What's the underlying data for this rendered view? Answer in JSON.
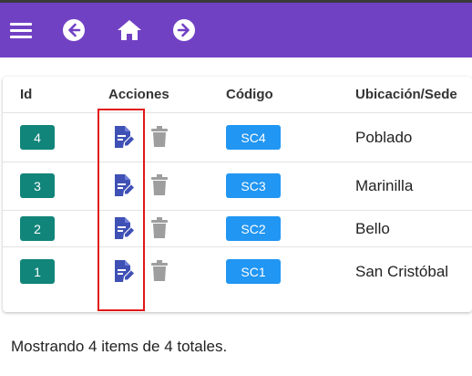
{
  "nav": {
    "menu_icon": "hamburger-icon",
    "back_icon": "arrow-left-circle-icon",
    "home_icon": "home-icon",
    "forward_icon": "arrow-right-circle-icon"
  },
  "table": {
    "headers": {
      "id": "Id",
      "actions": "Acciones",
      "code": "Código",
      "location": "Ubicación/Sede"
    },
    "rows": [
      {
        "id": "4",
        "code": "SC4",
        "location": "Poblado"
      },
      {
        "id": "3",
        "code": "SC3",
        "location": "Marinilla"
      },
      {
        "id": "2",
        "code": "SC2",
        "location": "Bello"
      },
      {
        "id": "1",
        "code": "SC1",
        "location": "San Cristóbal"
      }
    ],
    "edit_icon": "edit-document-icon",
    "delete_icon": "trash-icon"
  },
  "footer": {
    "summary": "Mostrando 4 items de 4 totales."
  },
  "colors": {
    "appbar": "#7141c4",
    "id_badge": "#11857a",
    "code_badge": "#2196f3",
    "edit_icon": "#3f51b5",
    "delete_icon": "#9e9e9e",
    "highlight": "#e01818"
  }
}
